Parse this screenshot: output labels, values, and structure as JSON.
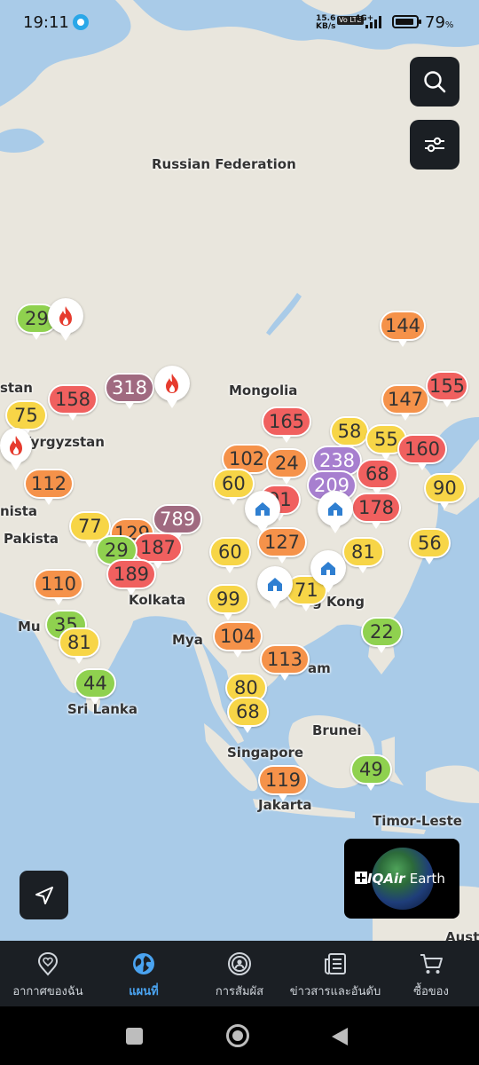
{
  "status_bar": {
    "time": "19:11",
    "net_speed_value": "15.6",
    "net_speed_unit": "KB/s",
    "volte": "Vo LTE",
    "network": "4G+",
    "battery_percent": "79",
    "battery_unit": "%"
  },
  "map": {
    "labels": {
      "russia": "Russian Federation",
      "mongolia": "Mongolia",
      "kazakhstan": "stan",
      "kyrgyzstan": "Kyrgyzstan",
      "turkmenistan": "nista",
      "pakistan": "Pakista",
      "kolkata": "Kolkata",
      "mumbai": "Mu",
      "myanmar": "Mya",
      "hongkong": "g Kong",
      "vietnam": "am",
      "srilanka": "Sri Lanka",
      "brunei": "Brunei",
      "singapore": "Singapore",
      "jakarta": "Jakarta",
      "timorleste": "Timor-Leste",
      "australia": "Aust"
    },
    "aqi_markers": [
      {
        "id": "m1",
        "value": "29",
        "level": "good"
      },
      {
        "id": "m2",
        "value": "144",
        "level": "unhealthy-sensitive"
      },
      {
        "id": "m3",
        "value": "318",
        "level": "hazardous"
      },
      {
        "id": "m4",
        "value": "158",
        "level": "unhealthy"
      },
      {
        "id": "m5",
        "value": "75",
        "level": "moderate"
      },
      {
        "id": "m6",
        "value": "147",
        "level": "unhealthy-sensitive"
      },
      {
        "id": "m7",
        "value": "155",
        "level": "unhealthy"
      },
      {
        "id": "m8",
        "value": "165",
        "level": "unhealthy"
      },
      {
        "id": "m9",
        "value": "58",
        "level": "moderate"
      },
      {
        "id": "m10",
        "value": "55",
        "level": "moderate"
      },
      {
        "id": "m11",
        "value": "160",
        "level": "unhealthy"
      },
      {
        "id": "m12",
        "value": "102",
        "level": "unhealthy-sensitive"
      },
      {
        "id": "m13",
        "value": "24",
        "level": "unhealthy-sensitive"
      },
      {
        "id": "m14",
        "value": "238",
        "level": "very-unhealthy"
      },
      {
        "id": "m15",
        "value": "68",
        "level": "unhealthy"
      },
      {
        "id": "m16",
        "value": "209",
        "level": "very-unhealthy"
      },
      {
        "id": "m17",
        "value": "90",
        "level": "moderate"
      },
      {
        "id": "m18",
        "value": "112",
        "level": "unhealthy-sensitive"
      },
      {
        "id": "m19",
        "value": "60",
        "level": "moderate"
      },
      {
        "id": "m20",
        "value": "91",
        "level": "unhealthy"
      },
      {
        "id": "m21",
        "value": "178",
        "level": "unhealthy"
      },
      {
        "id": "m22",
        "value": "789",
        "level": "hazardous"
      },
      {
        "id": "m23",
        "value": "77",
        "level": "moderate"
      },
      {
        "id": "m24",
        "value": "129",
        "level": "unhealthy-sensitive"
      },
      {
        "id": "m25",
        "value": "187",
        "level": "unhealthy"
      },
      {
        "id": "m26",
        "value": "29",
        "level": "good"
      },
      {
        "id": "m27",
        "value": "127",
        "level": "unhealthy-sensitive"
      },
      {
        "id": "m28",
        "value": "81",
        "level": "moderate"
      },
      {
        "id": "m29",
        "value": "56",
        "level": "moderate"
      },
      {
        "id": "m30",
        "value": "60",
        "level": "moderate"
      },
      {
        "id": "m31",
        "value": "189",
        "level": "unhealthy"
      },
      {
        "id": "m32",
        "value": "110",
        "level": "unhealthy-sensitive"
      },
      {
        "id": "m33",
        "value": "99",
        "level": "moderate"
      },
      {
        "id": "m34",
        "value": "71",
        "level": "moderate"
      },
      {
        "id": "m35",
        "value": "35",
        "level": "good"
      },
      {
        "id": "m36",
        "value": "22",
        "level": "good"
      },
      {
        "id": "m37",
        "value": "104",
        "level": "unhealthy-sensitive"
      },
      {
        "id": "m38",
        "value": "81",
        "level": "moderate"
      },
      {
        "id": "m39",
        "value": "113",
        "level": "unhealthy-sensitive"
      },
      {
        "id": "m40",
        "value": "44",
        "level": "good"
      },
      {
        "id": "m41",
        "value": "80",
        "level": "moderate"
      },
      {
        "id": "m42",
        "value": "68",
        "level": "moderate"
      },
      {
        "id": "m43",
        "value": "49",
        "level": "good"
      },
      {
        "id": "m44",
        "value": "119",
        "level": "unhealthy-sensitive"
      }
    ],
    "level_colors": {
      "good": "#8fd14f",
      "moderate": "#f7d547",
      "unhealthy-sensitive": "#f5924a",
      "unhealthy": "#f0605f",
      "very-unhealthy": "#a77fcf",
      "hazardous": "#a06a80"
    },
    "icon_markers": [
      "fire-icon",
      "fire-icon",
      "fire-icon",
      "station-icon",
      "station-icon",
      "station-icon",
      "station-icon"
    ]
  },
  "promo": {
    "brand": "IQAir",
    "product": "Earth"
  },
  "bottom_nav": {
    "items": [
      {
        "label": "อากาศของฉัน",
        "icon": "heart-location-icon",
        "active": false
      },
      {
        "label": "แผนที่",
        "icon": "globe-icon",
        "active": true
      },
      {
        "label": "การสัมผัส",
        "icon": "exposure-icon",
        "active": false
      },
      {
        "label": "ข่าวสารและอันดับ",
        "icon": "news-icon",
        "active": false
      },
      {
        "label": "ซื้อของ",
        "icon": "cart-icon",
        "active": false
      }
    ]
  }
}
